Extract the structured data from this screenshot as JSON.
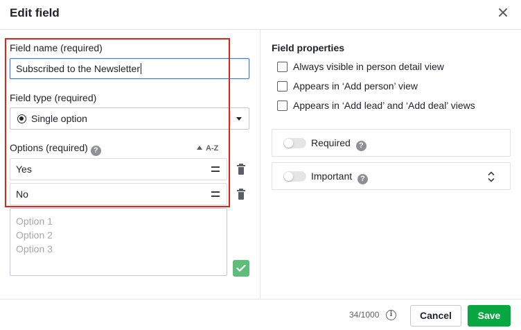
{
  "header": {
    "title": "Edit field",
    "close_icon": "close-icon"
  },
  "field_name": {
    "label": "Field name (required)",
    "value": "Subscribed to the Newsletter"
  },
  "field_type": {
    "label": "Field type (required)",
    "selected": "Single option",
    "icon": "radio-icon"
  },
  "options": {
    "label": "Options (required)",
    "sort_label": "A-Z",
    "items": [
      {
        "label": "Yes"
      },
      {
        "label": "No"
      }
    ],
    "placeholder": "Option 1\nOption 2\nOption 3"
  },
  "properties": {
    "title": "Field properties",
    "checkboxes": [
      {
        "label": "Always visible in person detail view",
        "checked": false
      },
      {
        "label": "Appears in ‘Add person’ view",
        "checked": false
      },
      {
        "label": "Appears in ‘Add lead’ and ‘Add deal’ views",
        "checked": false
      }
    ],
    "toggles": [
      {
        "label": "Required",
        "on": false
      },
      {
        "label": "Important",
        "on": false
      }
    ]
  },
  "footer": {
    "counter": "34/1000",
    "cancel_label": "Cancel",
    "save_label": "Save"
  },
  "colors": {
    "accent": "#317ae2",
    "save": "#08a742",
    "highlight": "#e0231a",
    "confirm": "#5ebd7a"
  }
}
